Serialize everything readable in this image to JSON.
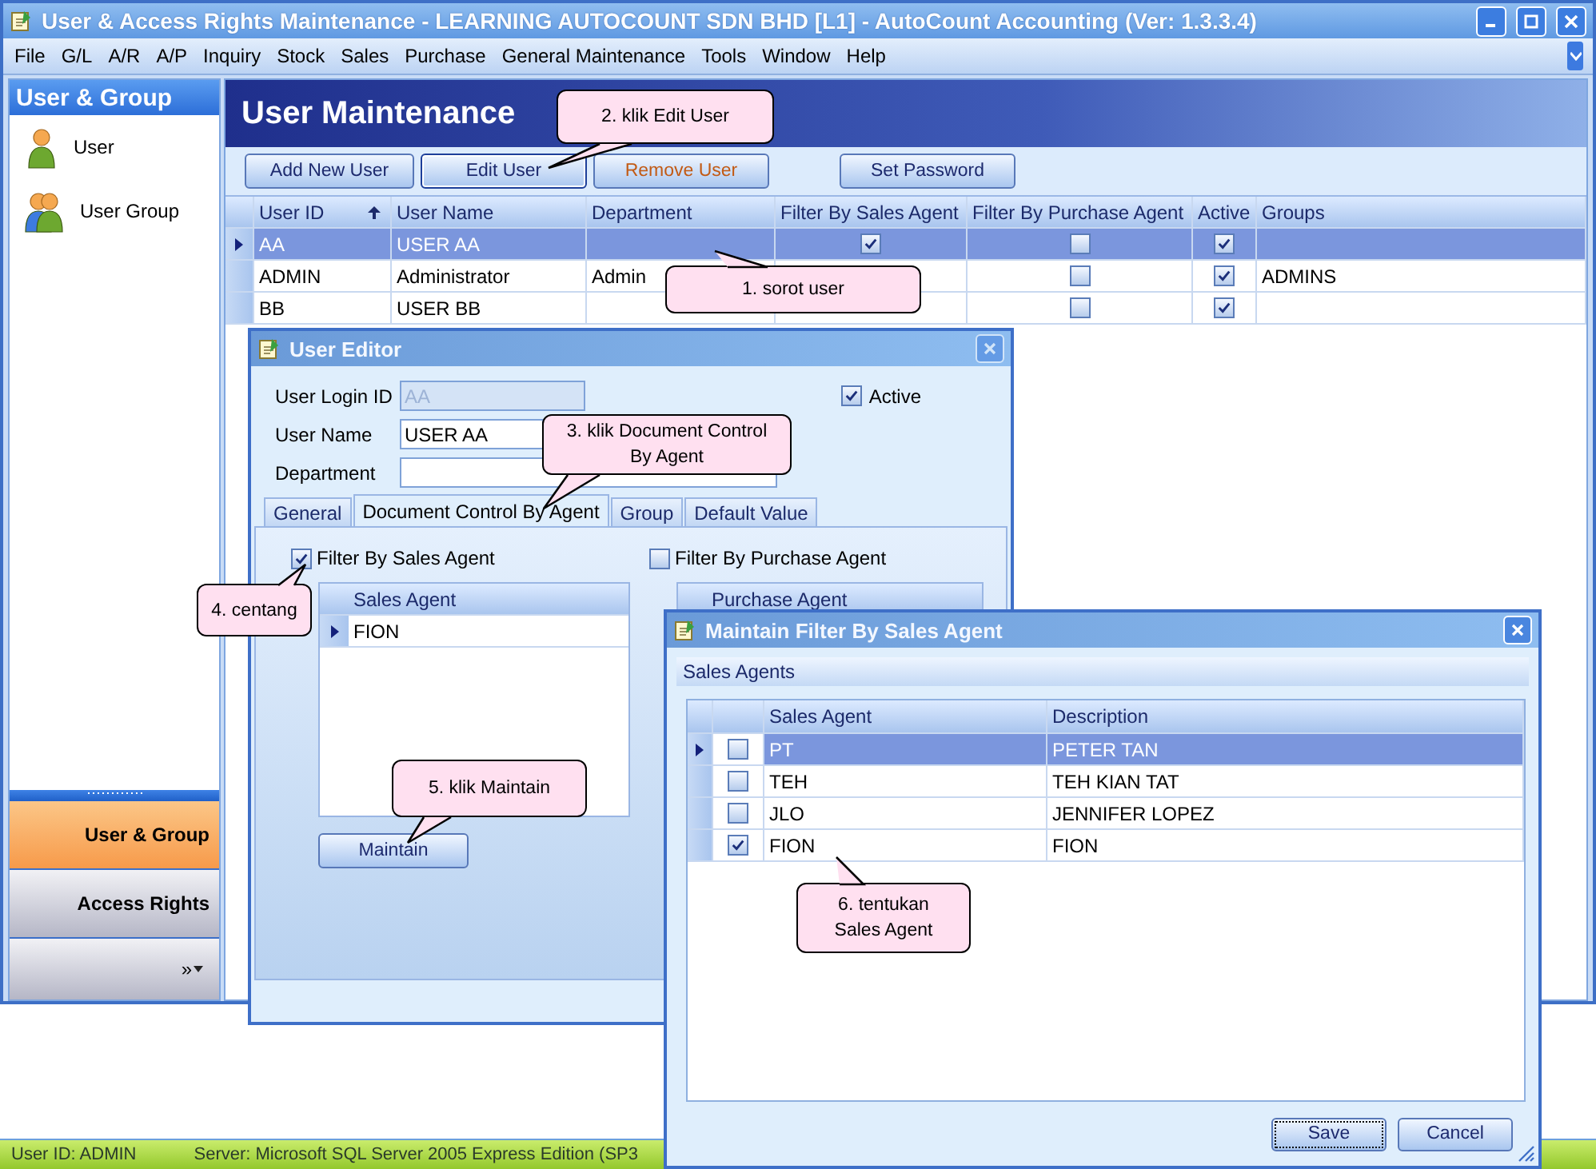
{
  "window": {
    "title": "User & Access Rights Maintenance - LEARNING AUTOCOUNT SDN BHD [L1] - AutoCount Accounting (Ver: 1.3.3.4)"
  },
  "menu": [
    "File",
    "G/L",
    "A/R",
    "A/P",
    "Inquiry",
    "Stock",
    "Sales",
    "Purchase",
    "General Maintenance",
    "Tools",
    "Window",
    "Help"
  ],
  "sidebar": {
    "title": "User & Group",
    "items": [
      {
        "label": "User",
        "kind": "user"
      },
      {
        "label": "User Group",
        "kind": "group"
      }
    ],
    "nav": [
      {
        "label": "User & Group",
        "selected": true
      },
      {
        "label": "Access Rights",
        "selected": false
      }
    ],
    "more": "»"
  },
  "page": {
    "title": "User Maintenance",
    "buttons": [
      {
        "label": "Add New User",
        "kind": "normal"
      },
      {
        "label": "Edit User",
        "kind": "focused"
      },
      {
        "label": "Remove User",
        "kind": "warning"
      },
      {
        "label": "Set Password",
        "kind": "normal"
      }
    ]
  },
  "users_table": {
    "columns": [
      "User ID",
      "User Name",
      "Department",
      "Filter By Sales Agent",
      "Filter By Purchase Agent",
      "Active",
      "Groups"
    ],
    "rows": [
      {
        "user_id": "AA",
        "user_name": "USER AA",
        "filter_sales": true,
        "filter_purchase": false,
        "active": true,
        "selected": true
      },
      {
        "user_id": "ADMIN",
        "user_name": "Administrator",
        "department": "Admin",
        "filter_purchase": false,
        "active": true,
        "groups": "ADMINS",
        "selected": false
      },
      {
        "user_id": "BB",
        "user_name": "USER BB",
        "filter_purchase": false,
        "active": true,
        "selected": false
      }
    ]
  },
  "user_editor": {
    "title": "User Editor",
    "fields": [
      {
        "label": "User Login ID",
        "value": "AA",
        "disabled": true
      },
      {
        "label": "User Name",
        "value": "USER AA",
        "disabled": false
      },
      {
        "label": "Department",
        "disabled": false
      }
    ],
    "active": {
      "label": "Active",
      "checked": true
    },
    "tabs": [
      {
        "label": "General",
        "selected": false
      },
      {
        "label": "Document Control By Agent",
        "selected": true
      },
      {
        "label": "Group",
        "selected": false
      },
      {
        "label": "Default Value",
        "selected": false
      }
    ],
    "filter_sales": {
      "label": "Filter By Sales Agent",
      "checked": true
    },
    "filter_purchase": {
      "label": "Filter By Purchase Agent",
      "checked": false
    },
    "sales_grid": {
      "column": "Sales Agent",
      "rows": [
        {
          "value": "FION",
          "selected": true
        }
      ]
    },
    "purchase_grid": {
      "column": "Purchase Agent"
    },
    "maintain_button": "Maintain"
  },
  "maintain_dialog": {
    "title": "Maintain Filter By Sales Agent",
    "group": "Sales Agents",
    "columns": [
      "Sales Agent",
      "Description"
    ],
    "rows": [
      {
        "code": "PT",
        "description": "PETER TAN",
        "checked": false,
        "selected": true
      },
      {
        "code": "TEH",
        "description": "TEH KIAN TAT",
        "checked": false,
        "selected": false
      },
      {
        "code": "JLO",
        "description": "JENNIFER LOPEZ",
        "checked": false,
        "selected": false
      },
      {
        "code": "FION",
        "description": "FION",
        "checked": true,
        "selected": false
      }
    ],
    "buttons": [
      {
        "label": "Save",
        "default": true
      },
      {
        "label": "Cancel",
        "default": false
      }
    ]
  },
  "callouts": [
    {
      "text": "1. sorot user"
    },
    {
      "text": "2. klik Edit User"
    },
    {
      "text": "3. klik Document Control By Agent"
    },
    {
      "text": "4. centang"
    },
    {
      "text": "5. klik Maintain"
    },
    {
      "text": "6. tentukan Sales Agent"
    }
  ],
  "status_bar": [
    "User ID: ADMIN",
    "Server: Microsoft SQL Server 2005 Express Edition (SP3"
  ]
}
